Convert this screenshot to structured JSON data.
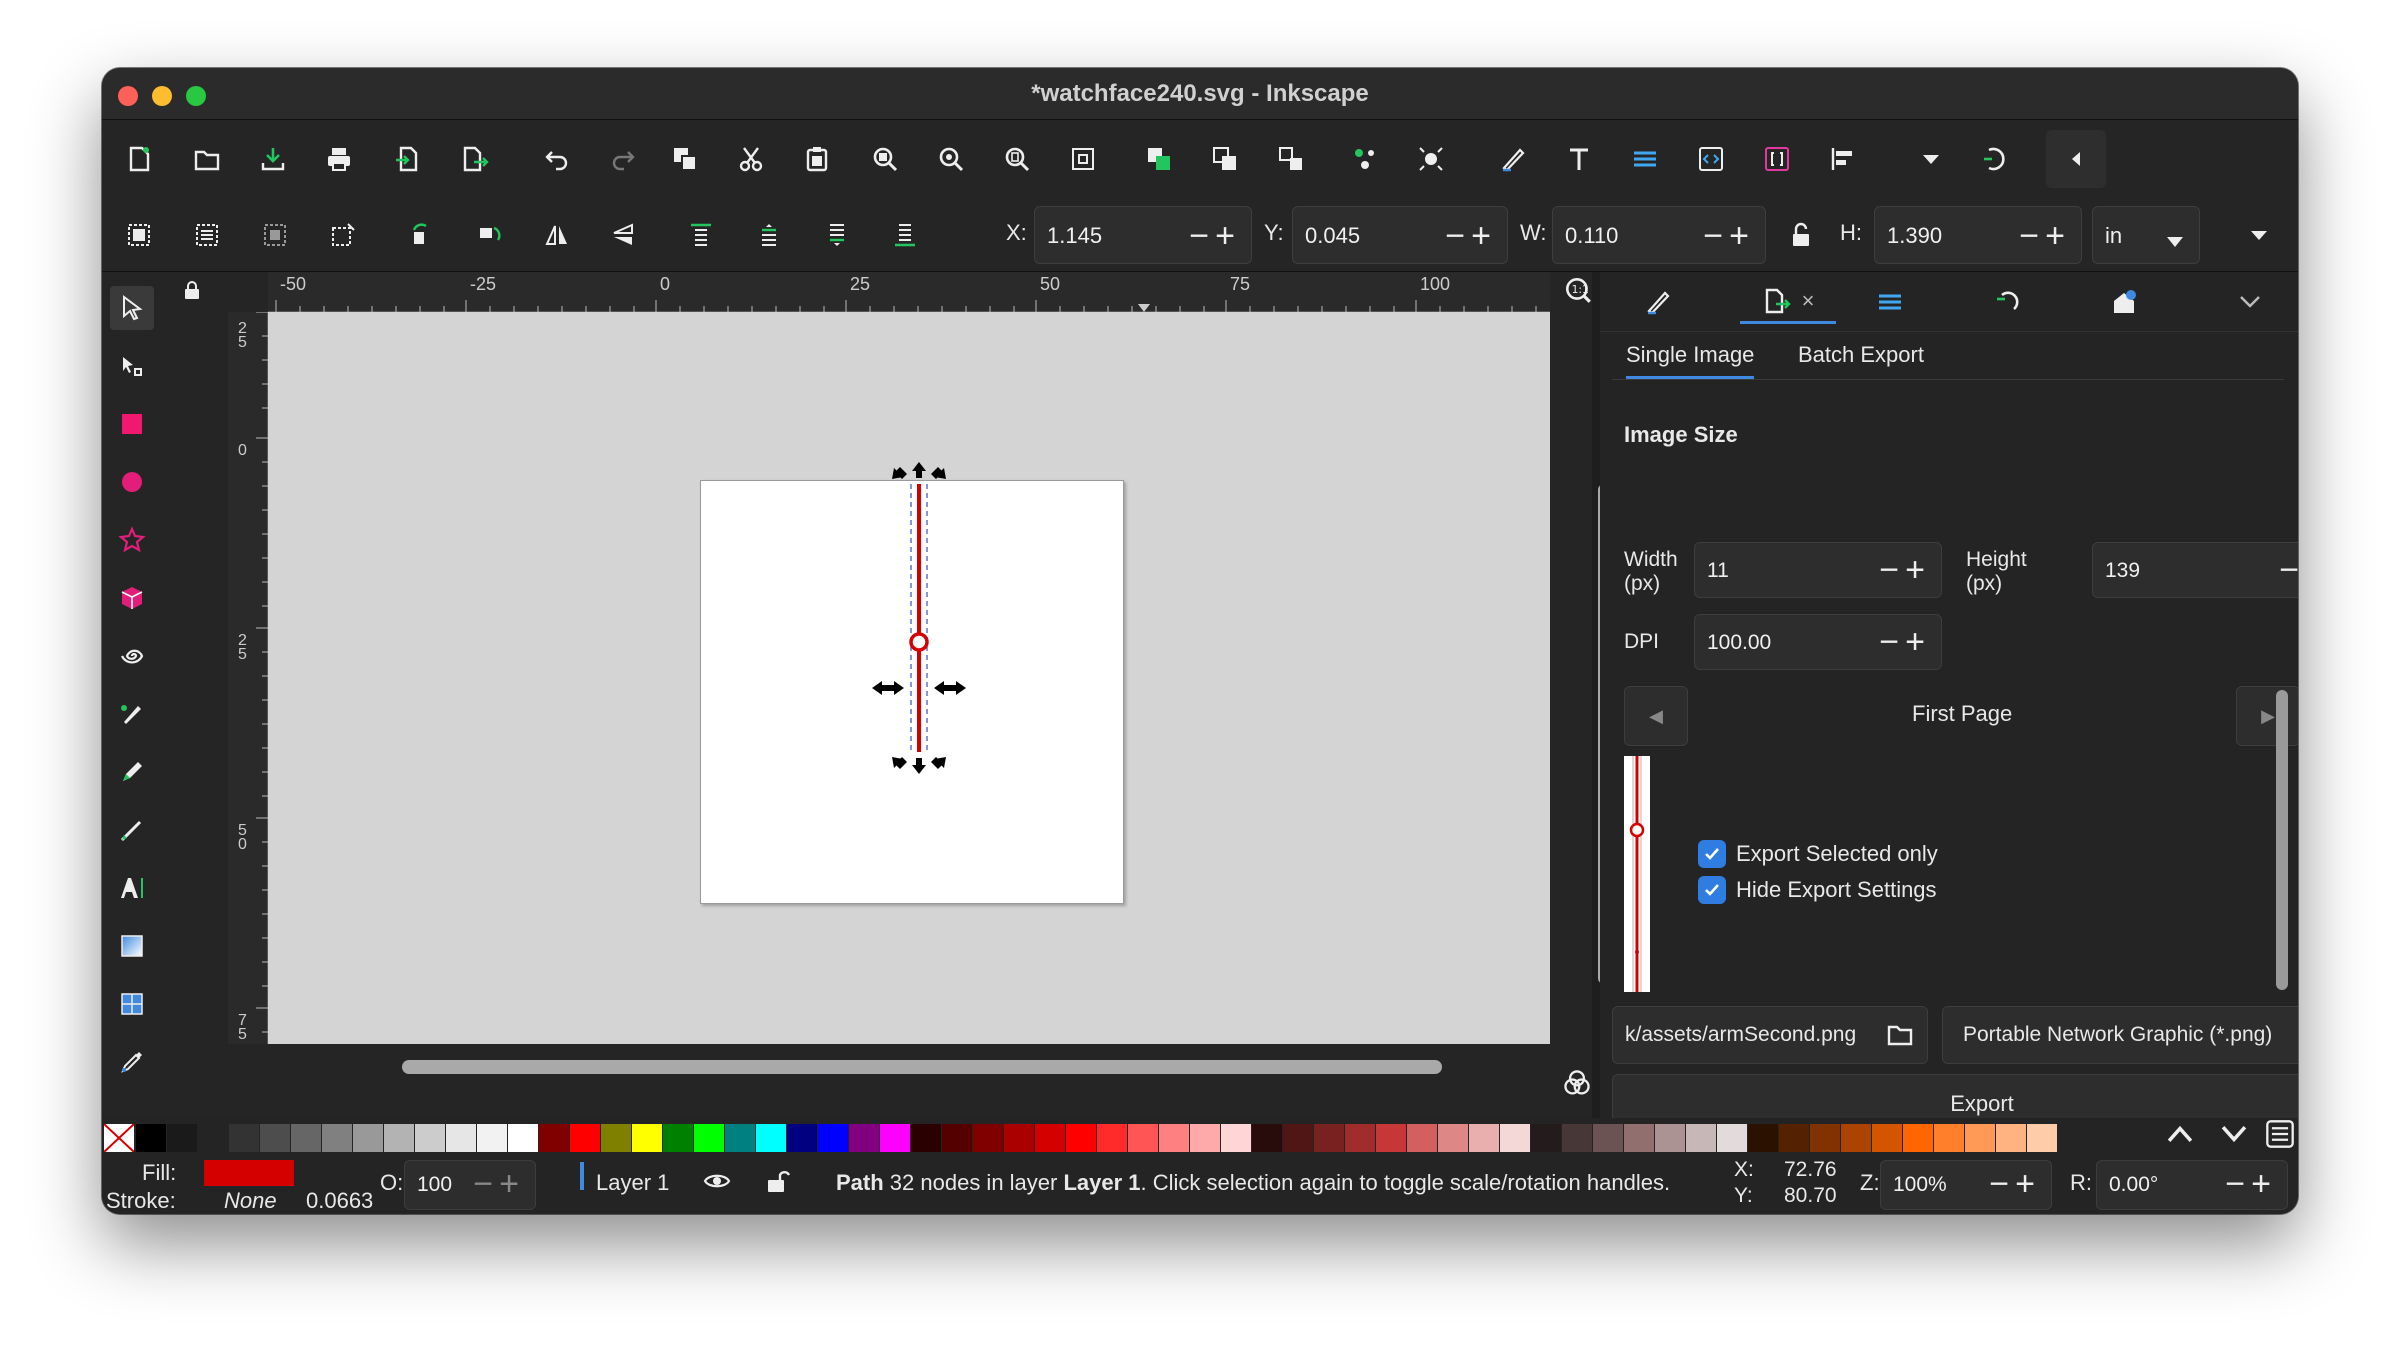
{
  "window": {
    "title": "*watchface240.svg - Inkscape"
  },
  "toolbar": {
    "icons": [
      "new-document",
      "open",
      "save",
      "print",
      "import",
      "export",
      "undo",
      "redo",
      "duplicate",
      "cut",
      "paste",
      "zoom-selection",
      "zoom-drawing",
      "zoom-page",
      "zoom-fit",
      "group",
      "lock",
      "unlock",
      "nodes",
      "objects",
      "fill-stroke",
      "text",
      "layers",
      "xml-editor",
      "css",
      "align",
      "more"
    ]
  },
  "select_toolbar": {
    "x_label": "X:",
    "x_value": "1.145",
    "y_label": "Y:",
    "y_value": "0.045",
    "w_label": "W:",
    "w_value": "0.110",
    "h_label": "H:",
    "h_value": "1.390",
    "unit": "in"
  },
  "rulers": {
    "h_ticks": [
      "-50",
      "-25",
      "0",
      "25",
      "50",
      "75",
      "100"
    ],
    "v_ticks": [
      "2\n5",
      "0",
      "2\n5",
      "5\n0",
      "7\n5"
    ]
  },
  "panel": {
    "subtabs": [
      "Single Image",
      "Batch Export"
    ],
    "section_title": "Image Size",
    "width_label_1": "Width",
    "width_label_2": "(px)",
    "width_value": "11",
    "height_label_1": "Height",
    "height_label_2": "(px)",
    "height_value": "139",
    "dpi_label": "DPI",
    "dpi_value": "100.00",
    "page_label": "First Page",
    "export_selected_only": "Export Selected only",
    "hide_export_settings": "Hide Export Settings",
    "file_path": "k/assets/armSecond.png",
    "format": "Portable Network Graphic (*.png)",
    "export_button": "Export"
  },
  "status": {
    "fill_label": "Fill:",
    "stroke_label": "Stroke:",
    "stroke_value": "None",
    "stroke_width": "0.0663",
    "opacity_label": "O:",
    "opacity_value": "100",
    "layer": "Layer 1",
    "message_bold1": "Path",
    "message_mid": " 32 nodes in layer ",
    "message_bold2": "Layer 1",
    "message_end": ". Click selection again to toggle scale/rotation handles.",
    "cursor_x_label": "X:",
    "cursor_x": "72.76",
    "cursor_y_label": "Y:",
    "cursor_y": "80.70",
    "zoom_label": "Z:",
    "zoom_value": "100%",
    "rotation_label": "R:",
    "rotation_value": "0.00°"
  },
  "colors": {
    "fill": "#d40000",
    "accent": "#3f8ae0"
  }
}
